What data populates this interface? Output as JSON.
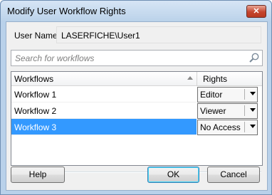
{
  "window": {
    "title": "Modify User Workflow Rights",
    "close_glyph": "✕"
  },
  "user": {
    "label": "User Name:",
    "value": "LASERFICHE\\User1"
  },
  "search": {
    "placeholder": "Search for workflows"
  },
  "table": {
    "columns": {
      "workflows": "Workflows",
      "rights": "Rights"
    },
    "rows": [
      {
        "name": "Workflow 1",
        "right": "Editor",
        "selected": false
      },
      {
        "name": "Workflow 2",
        "right": "Viewer",
        "selected": false
      },
      {
        "name": "Workflow 3",
        "right": "No Access",
        "selected": true
      }
    ]
  },
  "buttons": {
    "help": "Help",
    "ok": "OK",
    "cancel": "Cancel"
  },
  "colors": {
    "selection": "#3399ff",
    "dialog_bg": "#f0f0f0"
  }
}
